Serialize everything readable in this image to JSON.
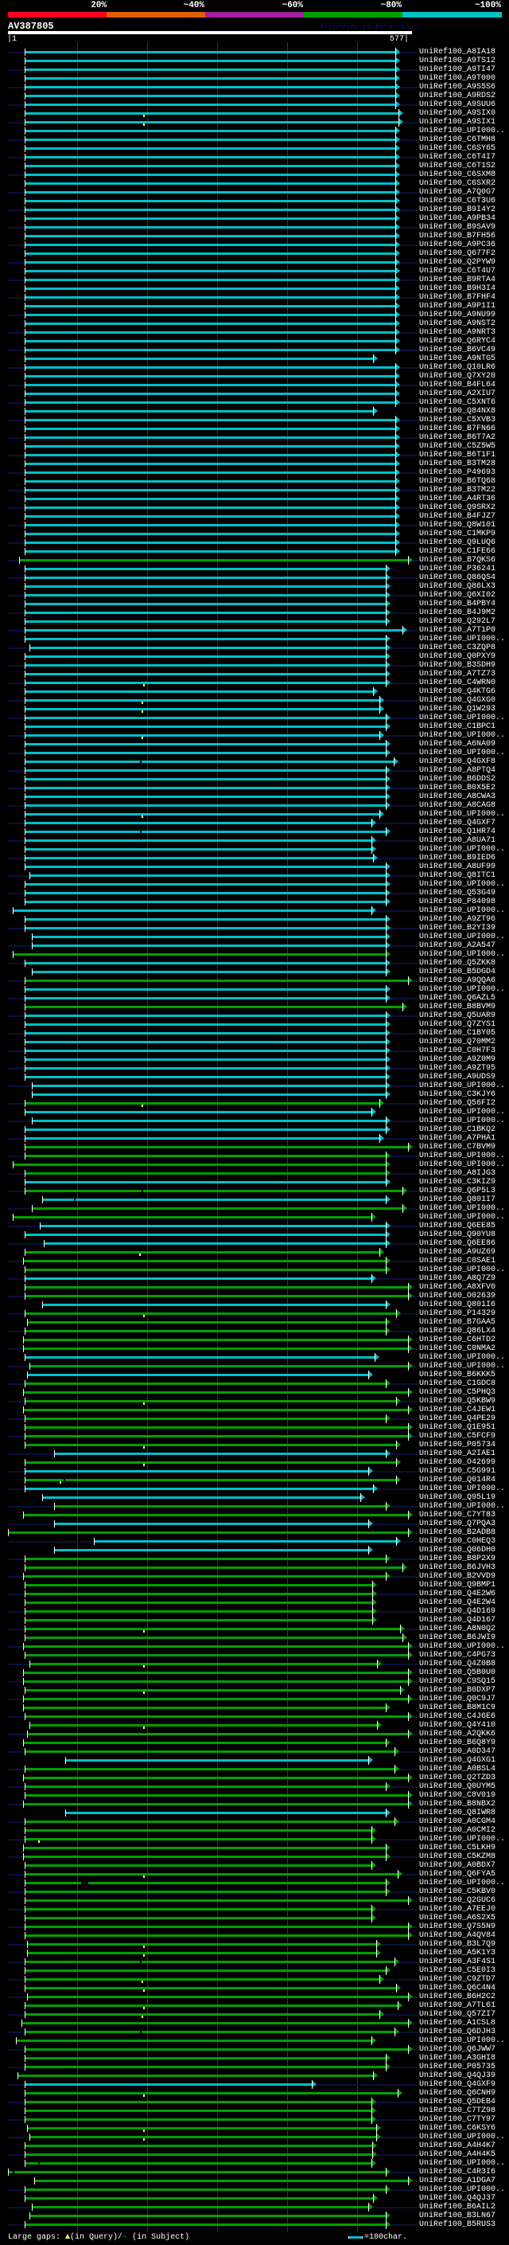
{
  "scale": {
    "labels": [
      "20%",
      "~40%",
      "~60%",
      "~80%",
      "~100%"
    ],
    "colors": [
      "#ff0022",
      "#e06000",
      "#a020a0",
      "#00a000",
      "#00c0c8"
    ]
  },
  "query": {
    "name": "AV387805",
    "start": "|1",
    "end": "577|",
    "length": 577
  },
  "version": "AlignView.pm Beta rel.7",
  "footer": {
    "gaps_label": "Large gaps:",
    "query_gap": "(in Query)/",
    "subject_gap_glyph": "-",
    "subject_gap": " (in Subject)",
    "legend": "=100char."
  },
  "bar_colors": {
    "c": "#00c0c8",
    "g": "#00a000"
  },
  "rows": [
    [
      "UniRef100_A8IA18",
      "c",
      25,
      554
    ],
    [
      "UniRef100_A9TS12",
      "c",
      25,
      554
    ],
    [
      "UniRef100_A9TI47",
      "c",
      25,
      554
    ],
    [
      "UniRef100_A9T000",
      "c",
      25,
      554
    ],
    [
      "UniRef100_A9S5S6",
      "c",
      25,
      554
    ],
    [
      "UniRef100_A9RDS2",
      "c",
      25,
      554
    ],
    [
      "UniRef100_A9SUU6",
      "c",
      25,
      554
    ],
    [
      "UniRef100_A9SIX0",
      "c",
      25,
      559,
      194
    ],
    [
      "UniRef100_A9SIX1",
      "c",
      25,
      559,
      194
    ],
    [
      "UniRef100_UPI000..",
      "c",
      25,
      554
    ],
    [
      "UniRef100_C6TMH8",
      "c",
      25,
      554
    ],
    [
      "UniRef100_C6SY65",
      "c",
      25,
      554
    ],
    [
      "UniRef100_C6T4I7",
      "c",
      25,
      554
    ],
    [
      "UniRef100_C6T1S2",
      "c",
      25,
      554
    ],
    [
      "UniRef100_C6SXM8",
      "c",
      25,
      554
    ],
    [
      "UniRef100_C6SXR2",
      "c",
      25,
      554
    ],
    [
      "UniRef100_A7Q0G7",
      "c",
      25,
      554
    ],
    [
      "UniRef100_C6T3U6",
      "c",
      25,
      554
    ],
    [
      "UniRef100_B9I4Y2",
      "c",
      25,
      554
    ],
    [
      "UniRef100_A9PB34",
      "c",
      25,
      554
    ],
    [
      "UniRef100_B9SAV9",
      "c",
      25,
      554
    ],
    [
      "UniRef100_B7FH56",
      "c",
      25,
      554
    ],
    [
      "UniRef100_A9PC36",
      "c",
      25,
      554
    ],
    [
      "UniRef100_Q677F2",
      "c",
      25,
      554
    ],
    [
      "UniRef100_Q2PYW9",
      "c",
      25,
      554
    ],
    [
      "UniRef100_C6T4U7",
      "c",
      25,
      554
    ],
    [
      "UniRef100_B9RTA4",
      "c",
      25,
      554
    ],
    [
      "UniRef100_B9H3I4",
      "c",
      25,
      554
    ],
    [
      "UniRef100_B7FHF4",
      "c",
      25,
      554
    ],
    [
      "UniRef100_A9P1I1",
      "c",
      25,
      554
    ],
    [
      "UniRef100_A9NU99",
      "c",
      25,
      554
    ],
    [
      "UniRef100_A9NST2",
      "c",
      25,
      554
    ],
    [
      "UniRef100_A9NRT3",
      "c",
      25,
      554
    ],
    [
      "UniRef100_Q6RYC4",
      "c",
      25,
      554
    ],
    [
      "UniRef100_B6VC49",
      "c",
      25,
      554
    ],
    [
      "UniRef100_A9NTG5",
      "c",
      25,
      523
    ],
    [
      "UniRef100_Q10LR6",
      "c",
      25,
      554
    ],
    [
      "UniRef100_Q7XY20",
      "c",
      25,
      554
    ],
    [
      "UniRef100_B4FL64",
      "c",
      25,
      554
    ],
    [
      "UniRef100_A2XIU7",
      "c",
      25,
      554
    ],
    [
      "UniRef100_C5XNT6",
      "c",
      25,
      554
    ],
    [
      "UniRef100_Q84NX8",
      "c",
      25,
      523
    ],
    [
      "UniRef100_C5XVB3",
      "c",
      25,
      554
    ],
    [
      "UniRef100_B7FN66",
      "c",
      25,
      554
    ],
    [
      "UniRef100_B6T7A2",
      "c",
      25,
      554
    ],
    [
      "UniRef100_C5Z5W5",
      "c",
      25,
      554
    ],
    [
      "UniRef100_B6T1F1",
      "c",
      25,
      554
    ],
    [
      "UniRef100_B3TM28",
      "c",
      25,
      554
    ],
    [
      "UniRef100_P49693",
      "c",
      25,
      554
    ],
    [
      "UniRef100_B6TQ68",
      "c",
      25,
      554
    ],
    [
      "UniRef100_B3TM22",
      "c",
      25,
      554
    ],
    [
      "UniRef100_A4RT36",
      "c",
      25,
      554
    ],
    [
      "UniRef100_Q9SRX2",
      "c",
      25,
      554
    ],
    [
      "UniRef100_B4FJZ7",
      "c",
      25,
      554
    ],
    [
      "UniRef100_Q8W101",
      "c",
      25,
      554
    ],
    [
      "UniRef100_C1MKP9",
      "c",
      25,
      554
    ],
    [
      "UniRef100_Q9LUQ6",
      "c",
      25,
      554
    ],
    [
      "UniRef100_C1FE66",
      "c",
      25,
      554
    ],
    [
      "UniRef100_B7QKS6",
      "g",
      17,
      573
    ],
    [
      "UniRef100_P36241",
      "c",
      25,
      541
    ],
    [
      "UniRef100_Q86QS4",
      "c",
      25,
      541
    ],
    [
      "UniRef100_Q86LX3",
      "c",
      25,
      541
    ],
    [
      "UniRef100_Q6XI02",
      "c",
      25,
      541
    ],
    [
      "UniRef100_B4PBY4",
      "c",
      25,
      541
    ],
    [
      "UniRef100_B4J9M2",
      "c",
      25,
      541
    ],
    [
      "UniRef100_Q292L7",
      "c",
      25,
      541
    ],
    [
      "UniRef100_A7T1P0",
      "c",
      25,
      565
    ],
    [
      "UniRef100_UPI000..",
      "c",
      25,
      541
    ],
    [
      "UniRef100_C3ZQP8",
      "c",
      32,
      541
    ],
    [
      "UniRef100_Q0PXY9",
      "c",
      25,
      541
    ],
    [
      "UniRef100_B3SDH9",
      "c",
      25,
      541
    ],
    [
      "UniRef100_A7TZ73",
      "c",
      25,
      541
    ],
    [
      "UniRef100_C4WRN0",
      "c",
      25,
      541,
      194
    ],
    [
      "UniRef100_Q4KTG6",
      "c",
      25,
      523
    ],
    [
      "UniRef100_Q4GXG0",
      "c",
      25,
      532,
      192
    ],
    [
      "UniRef100_Q1W293",
      "c",
      25,
      532,
      192
    ],
    [
      "UniRef100_UPI000..",
      "c",
      25,
      541
    ],
    [
      "UniRef100_C1BPC1",
      "c",
      25,
      541
    ],
    [
      "UniRef100_UPI000..",
      "c",
      25,
      532,
      192
    ],
    [
      "UniRef100_A6NA09",
      "c",
      25,
      541
    ],
    [
      "UniRef100_UPI000..",
      "c",
      25,
      541
    ],
    [
      "UniRef100_Q4GXF8",
      "c",
      25,
      552,
      0,
      190
    ],
    [
      "UniRef100_A8PTQ4",
      "c",
      25,
      541
    ],
    [
      "UniRef100_B6DDS2",
      "c",
      25,
      541
    ],
    [
      "UniRef100_B0X5E2",
      "c",
      25,
      541
    ],
    [
      "UniRef100_A8CWA3",
      "c",
      25,
      541
    ],
    [
      "UniRef100_A8CAG8",
      "c",
      25,
      541
    ],
    [
      "UniRef100_UPI000..",
      "c",
      25,
      532,
      192
    ],
    [
      "UniRef100_Q4GXF7",
      "c",
      25,
      520
    ],
    [
      "UniRef100_Q1HR74",
      "c",
      25,
      541,
      0,
      190
    ],
    [
      "UniRef100_A8UA71",
      "c",
      25,
      520
    ],
    [
      "UniRef100_UPI000..",
      "c",
      25,
      520
    ],
    [
      "UniRef100_B9IED6",
      "c",
      25,
      523
    ],
    [
      "UniRef100_A8UF99",
      "c",
      25,
      541
    ],
    [
      "UniRef100_Q8ITC1",
      "c",
      32,
      541
    ],
    [
      "UniRef100_UPI000..",
      "c",
      25,
      541
    ],
    [
      "UniRef100_Q53G49",
      "c",
      25,
      541
    ],
    [
      "UniRef100_P84098",
      "c",
      25,
      541
    ],
    [
      "UniRef100_UPI000..",
      "c",
      8,
      520
    ],
    [
      "UniRef100_A9ZT96",
      "c",
      25,
      541
    ],
    [
      "UniRef100_B2YI39",
      "c",
      25,
      541
    ],
    [
      "UniRef100_UPI000..",
      "c",
      35,
      541
    ],
    [
      "UniRef100_A2A547",
      "c",
      35,
      541
    ],
    [
      "UniRef100_UPI000..",
      "g",
      8,
      541
    ],
    [
      "UniRef100_Q5ZKK8",
      "c",
      25,
      541
    ],
    [
      "UniRef100_B5DGD4",
      "c",
      35,
      541
    ],
    [
      "UniRef100_A9QQA6",
      "g",
      25,
      573
    ],
    [
      "UniRef100_UPI000..",
      "c",
      25,
      541
    ],
    [
      "UniRef100_Q6AZL5",
      "c",
      25,
      541
    ],
    [
      "UniRef100_B8BVM9",
      "g",
      25,
      565
    ],
    [
      "UniRef100_Q5UAR9",
      "c",
      25,
      541
    ],
    [
      "UniRef100_Q7ZYS1",
      "c",
      25,
      541
    ],
    [
      "UniRef100_C1BY05",
      "c",
      25,
      541
    ],
    [
      "UniRef100_Q70MM2",
      "c",
      25,
      541
    ],
    [
      "UniRef100_C0H7F3",
      "c",
      25,
      541
    ],
    [
      "UniRef100_A9Z0M9",
      "c",
      25,
      541
    ],
    [
      "UniRef100_A9ZT95",
      "c",
      25,
      541
    ],
    [
      "UniRef100_A9UDS9",
      "c",
      25,
      541
    ],
    [
      "UniRef100_UPI000..",
      "c",
      35,
      541
    ],
    [
      "UniRef100_C3KJY6",
      "c",
      35,
      541
    ],
    [
      "UniRef100_Q56FI2",
      "g",
      25,
      532,
      192
    ],
    [
      "UniRef100_UPI000..",
      "c",
      25,
      520
    ],
    [
      "UniRef100_UPI000..",
      "c",
      35,
      541
    ],
    [
      "UniRef100_C1BKQ2",
      "c",
      25,
      541
    ],
    [
      "UniRef100_A7PHA1",
      "c",
      25,
      532
    ],
    [
      "UniRef100_C7BVM9",
      "g",
      25,
      573
    ],
    [
      "UniRef100_UPI000..",
      "g",
      25,
      541
    ],
    [
      "UniRef100_UPI000..",
      "g",
      8,
      541
    ],
    [
      "UniRef100_A8IJG3",
      "g",
      25,
      541
    ],
    [
      "UniRef100_C3KIZ9",
      "c",
      25,
      541
    ],
    [
      "UniRef100_Q6P5L3",
      "g",
      25,
      565,
      0,
      192
    ],
    [
      "UniRef100_Q801I7",
      "c",
      50,
      541,
      0,
      95
    ],
    [
      "UniRef100_UPI000..",
      "g",
      35,
      565
    ],
    [
      "UniRef100_UPI000..",
      "g",
      8,
      520
    ],
    [
      "UniRef100_Q6EE85",
      "c",
      47,
      541
    ],
    [
      "UniRef100_Q90YU8",
      "c",
      25,
      541
    ],
    [
      "UniRef100_Q6EE86",
      "c",
      52,
      541
    ],
    [
      "UniRef100_A9UZ69",
      "g",
      25,
      532,
      188
    ],
    [
      "UniRef100_C0SAE1",
      "g",
      23,
      541
    ],
    [
      "UniRef100_UPI000..",
      "g",
      25,
      541
    ],
    [
      "UniRef100_A8Q7Z9",
      "c",
      25,
      520
    ],
    [
      "UniRef100_A8XFV0",
      "g",
      25,
      573
    ],
    [
      "UniRef100_O02639",
      "g",
      25,
      573
    ],
    [
      "UniRef100_Q801I6",
      "c",
      50,
      541
    ],
    [
      "UniRef100_P14329",
      "g",
      25,
      556,
      194
    ],
    [
      "UniRef100_B7GAA5",
      "g",
      28,
      541
    ],
    [
      "UniRef100_Q86LX4",
      "g",
      25,
      541
    ],
    [
      "UniRef100_C6HTD2",
      "g",
      23,
      573
    ],
    [
      "UniRef100_C0NMA2",
      "g",
      23,
      573
    ],
    [
      "UniRef100_UPI000..",
      "c",
      25,
      525
    ],
    [
      "UniRef100_UPI000..",
      "g",
      32,
      573
    ],
    [
      "UniRef100_B6KKK5",
      "c",
      28,
      516
    ],
    [
      "UniRef100_C1GDC8",
      "g",
      25,
      541
    ],
    [
      "UniRef100_C5PHQ3",
      "g",
      23,
      573
    ],
    [
      "UniRef100_Q5KBW9",
      "g",
      25,
      556,
      194
    ],
    [
      "UniRef100_C4JEW1",
      "g",
      23,
      573
    ],
    [
      "UniRef100_Q4PE29",
      "g",
      25,
      541
    ],
    [
      "UniRef100_Q1E951",
      "g",
      25,
      573
    ],
    [
      "UniRef100_C5FCF9",
      "g",
      25,
      573
    ],
    [
      "UniRef100_P05734",
      "g",
      25,
      556,
      194
    ],
    [
      "UniRef100_A2IAE1",
      "c",
      67,
      541
    ],
    [
      "UniRef100_O42699",
      "g",
      25,
      556,
      194
    ],
    [
      "UniRef100_C5G991",
      "c",
      25,
      516
    ],
    [
      "UniRef100_Q014R4",
      "g",
      25,
      556,
      75,
      80
    ],
    [
      "UniRef100_UPI000..",
      "c",
      25,
      523
    ],
    [
      "UniRef100_Q95L19",
      "c",
      50,
      504
    ],
    [
      "UniRef100_UPI000..",
      "g",
      67,
      541
    ],
    [
      "UniRef100_C7YT83",
      "g",
      23,
      573
    ],
    [
      "UniRef100_Q7PQA3",
      "c",
      67,
      516
    ],
    [
      "UniRef100_B2ADB8",
      "g",
      1,
      573
    ],
    [
      "UniRef100_C0HEQ3",
      "c",
      124,
      556
    ],
    [
      "UniRef100_Q06DH0",
      "c",
      67,
      516
    ],
    [
      "UniRef100_B8P2X9",
      "g",
      25,
      541
    ],
    [
      "UniRef100_B6JVH3",
      "g",
      25,
      565
    ],
    [
      "UniRef100_B2VVD9",
      "g",
      23,
      541
    ],
    [
      "UniRef100_Q9BMP1",
      "g",
      25,
      522
    ],
    [
      "UniRef100_Q4E2W6",
      "g",
      25,
      522
    ],
    [
      "UniRef100_Q4E2W4",
      "g",
      25,
      522
    ],
    [
      "UniRef100_Q4D169",
      "g",
      25,
      522
    ],
    [
      "UniRef100_Q4D167",
      "g",
      25,
      522
    ],
    [
      "UniRef100_A8N0Q2",
      "g",
      25,
      561,
      194
    ],
    [
      "UniRef100_B6JWI9",
      "g",
      25,
      565
    ],
    [
      "UniRef100_UPI000..",
      "g",
      23,
      573
    ],
    [
      "UniRef100_C4PG73",
      "g",
      25,
      573
    ],
    [
      "UniRef100_Q4Z0B8",
      "g",
      32,
      528,
      194
    ],
    [
      "UniRef100_Q5B0U0",
      "g",
      23,
      573
    ],
    [
      "UniRef100_C9SQ15",
      "g",
      23,
      573
    ],
    [
      "UniRef100_B0DXP7",
      "g",
      25,
      561,
      194
    ],
    [
      "UniRef100_Q0C9J7",
      "g",
      23,
      573
    ],
    [
      "UniRef100_B8M1C9",
      "g",
      23,
      541
    ],
    [
      "UniRef100_C4J6E6",
      "g",
      25,
      573
    ],
    [
      "UniRef100_Q4Y410",
      "g",
      32,
      528,
      194
    ],
    [
      "UniRef100_A2QKK6",
      "g",
      28,
      573
    ],
    [
      "UniRef100_B6Q8Y9",
      "g",
      23,
      541
    ],
    [
      "UniRef100_A0D347",
      "g",
      25,
      553
    ],
    [
      "UniRef100_Q4GXG1",
      "c",
      83,
      516
    ],
    [
      "UniRef100_A0BSL4",
      "g",
      25,
      553
    ],
    [
      "UniRef100_Q2TZD3",
      "g",
      23,
      573
    ],
    [
      "UniRef100_Q0UYM5",
      "g",
      25,
      541
    ],
    [
      "UniRef100_C8V019",
      "g",
      25,
      573
    ],
    [
      "UniRef100_B8NBX2",
      "g",
      23,
      573
    ],
    [
      "UniRef100_Q8IWR8",
      "c",
      83,
      541
    ],
    [
      "UniRef100_A0CGM4",
      "g",
      25,
      553
    ],
    [
      "UniRef100_A0CMI2",
      "g",
      25,
      520
    ],
    [
      "UniRef100_UPI000..",
      "g",
      25,
      520,
      44
    ],
    [
      "UniRef100_C5LKH9",
      "g",
      23,
      541
    ],
    [
      "UniRef100_C5KZM8",
      "g",
      23,
      541
    ],
    [
      "UniRef100_A0BDX7",
      "g",
      25,
      520
    ],
    [
      "UniRef100_Q6FYA5",
      "g",
      25,
      558,
      194
    ],
    [
      "UniRef100_UPI000..",
      "g",
      25,
      541,
      0,
      106
    ],
    [
      "UniRef100_C5KBV0",
      "g",
      25,
      541
    ],
    [
      "UniRef100_Q2GUC6",
      "g",
      25,
      573
    ],
    [
      "UniRef100_A7EEJ0",
      "g",
      25,
      520
    ],
    [
      "UniRef100_A6S2X5",
      "g",
      25,
      520
    ],
    [
      "UniRef100_Q7S5N9",
      "g",
      25,
      573
    ],
    [
      "UniRef100_A4QV84",
      "g",
      25,
      573
    ],
    [
      "UniRef100_B3L7Q9",
      "g",
      28,
      527,
      194
    ],
    [
      "UniRef100_A5K1Y3",
      "g",
      28,
      527,
      194
    ],
    [
      "UniRef100_A3F4S1",
      "g",
      25,
      553,
      0,
      190
    ],
    [
      "UniRef100_C5E0I3",
      "g",
      25,
      541
    ],
    [
      "UniRef100_C9ZTD7",
      "g",
      25,
      532,
      192
    ],
    [
      "UniRef100_Q6C4N4",
      "g",
      25,
      556,
      194
    ],
    [
      "UniRef100_B6H2C2",
      "g",
      28,
      573
    ],
    [
      "UniRef100_A7TL61",
      "g",
      25,
      558,
      194
    ],
    [
      "UniRef100_Q57ZI7",
      "g",
      25,
      532,
      192
    ],
    [
      "UniRef100_A1CSL8",
      "g",
      20,
      573
    ],
    [
      "UniRef100_Q6DJH3",
      "g",
      25,
      553,
      0,
      190
    ],
    [
      "UniRef100_UPI000..",
      "g",
      12,
      520
    ],
    [
      "UniRef100_Q6JWW7",
      "g",
      25,
      573
    ],
    [
      "UniRef100_A3GHI8",
      "g",
      25,
      541
    ],
    [
      "UniRef100_P05735",
      "g",
      25,
      541
    ],
    [
      "UniRef100_Q4QJ39",
      "g",
      15,
      523
    ],
    [
      "UniRef100_Q4GXF9",
      "c",
      25,
      435
    ],
    [
      "UniRef100_Q6CNH9",
      "g",
      25,
      558,
      194
    ],
    [
      "UniRef100_Q5DEB4",
      "g",
      25,
      520
    ],
    [
      "UniRef100_C7TZ98",
      "g",
      25,
      520
    ],
    [
      "UniRef100_C7TY97",
      "g",
      25,
      520
    ],
    [
      "UniRef100_C6KSY6",
      "g",
      28,
      527,
      194
    ],
    [
      "UniRef100_UPI000..",
      "g",
      32,
      527,
      194
    ],
    [
      "UniRef100_A4H4K7",
      "g",
      25,
      522
    ],
    [
      "UniRef100_A4H4K5",
      "g",
      25,
      522
    ],
    [
      "UniRef100_UPI000..",
      "g",
      25,
      520,
      0,
      44
    ],
    [
      "UniRef100_C4R3I6",
      "g",
      1,
      541,
      0,
      8
    ],
    [
      "UniRef100_A1DGA7",
      "g",
      38,
      573
    ],
    [
      "UniRef100_UPI000..",
      "g",
      25,
      541
    ],
    [
      "UniRef100_Q4QJ37",
      "g",
      25,
      523
    ],
    [
      "UniRef100_B6AIL2",
      "g",
      35,
      516
    ],
    [
      "UniRef100_B3LN67",
      "g",
      32,
      541
    ],
    [
      "UniRef100_B5RUS3",
      "g",
      25,
      541
    ]
  ]
}
